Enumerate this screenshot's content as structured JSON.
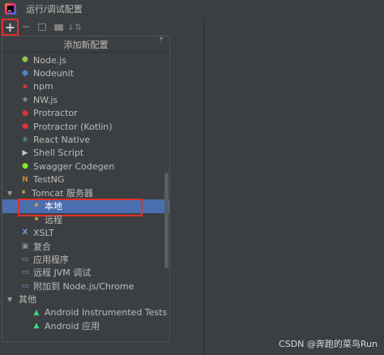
{
  "window": {
    "title": "运行/调试配置"
  },
  "toolbar": {
    "add_label": "+",
    "remove_label": "−",
    "sort_label": "↓⇅"
  },
  "popup": {
    "title": "添加新配置",
    "collapse_glyph": "⇡"
  },
  "items": [
    {
      "label": "Node.js",
      "icon": "nodejs-icon",
      "color": "#8cc84b",
      "level": 0
    },
    {
      "label": "Nodeunit",
      "icon": "nodeunit-icon",
      "color": "#4a86c8",
      "level": 0
    },
    {
      "label": "npm",
      "icon": "npm-icon",
      "color": "#cb3837",
      "level": 0
    },
    {
      "label": "NW.js",
      "icon": "nwjs-icon",
      "color": "#9a9a9a",
      "level": 0
    },
    {
      "label": "Protractor",
      "icon": "protractor-icon",
      "color": "#e23237",
      "level": 0
    },
    {
      "label": "Protractor (Kotlin)",
      "icon": "protractor-icon",
      "color": "#e23237",
      "level": 0
    },
    {
      "label": "React Native",
      "icon": "react-icon",
      "color": "#61dafb",
      "level": 0
    },
    {
      "label": "Shell Script",
      "icon": "shell-script-icon",
      "color": "#c8c8c8",
      "level": 0
    },
    {
      "label": "Swagger Codegen",
      "icon": "swagger-icon",
      "color": "#85ea2d",
      "level": 0
    },
    {
      "label": "TestNG",
      "icon": "testng-icon",
      "color": "#d0883c",
      "level": 0
    },
    {
      "label": "Tomcat 服务器",
      "icon": "tomcat-icon",
      "color": "#e8b64a",
      "level": 0,
      "expandable": true
    },
    {
      "label": "本地",
      "icon": "tomcat-icon",
      "color": "#e8b64a",
      "level": 1,
      "selected": true
    },
    {
      "label": "远程",
      "icon": "tomcat-icon",
      "color": "#e8b64a",
      "level": 1
    },
    {
      "label": "XSLT",
      "icon": "xslt-icon",
      "color": "#6c9ad4",
      "level": 0
    },
    {
      "label": "复合",
      "icon": "compound-icon",
      "color": "#8f8f8f",
      "level": 0
    },
    {
      "label": "应用程序",
      "icon": "application-icon",
      "color": "#7aa7d9",
      "level": 0
    },
    {
      "label": "远程 JVM 调试",
      "icon": "remote-jvm-debug-icon",
      "color": "#7aa7d9",
      "level": 0
    },
    {
      "label": "附加到 Node.js/Chrome",
      "icon": "attach-nodejs-icon",
      "color": "#6c9ad4",
      "level": 0
    },
    {
      "label": "其他",
      "icon": "",
      "color": "",
      "level": 0,
      "expandable": true
    },
    {
      "label": "Android Instrumented Tests",
      "icon": "android-icon",
      "color": "#3ddc84",
      "level": 1
    },
    {
      "label": "Android 应用",
      "icon": "android-icon",
      "color": "#3ddc84",
      "level": 1
    }
  ],
  "watermark": "CSDN @奔跑的菜鸟Run",
  "colors": {
    "background": "#3c3f41",
    "selection": "#4b6eaf",
    "highlight": "#e0302d"
  }
}
